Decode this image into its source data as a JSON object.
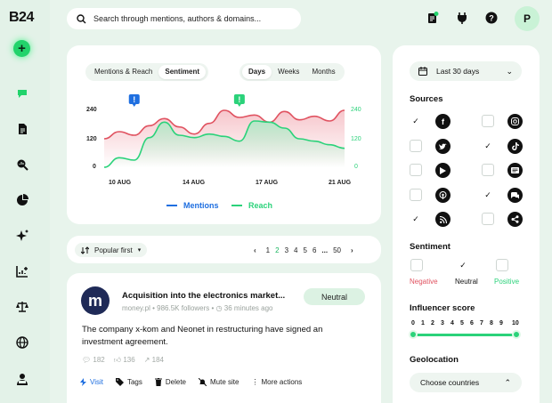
{
  "app": {
    "logo": "B24",
    "avatar_initial": "P"
  },
  "search": {
    "placeholder": "Search through mentions, authors & domains..."
  },
  "nav": {
    "items": [
      "chat-icon",
      "document-icon",
      "search-analytics-icon",
      "pie-chart-icon",
      "sparkle-icon",
      "chart-plus-icon",
      "scales-icon",
      "globe-icon",
      "user-icon"
    ]
  },
  "chart_panel": {
    "tabs": [
      "Mentions & Reach",
      "Sentiment"
    ],
    "active_tab": "Sentiment",
    "ranges": [
      "Days",
      "Weeks",
      "Months"
    ],
    "active_range": "Days"
  },
  "chart_data": {
    "type": "line",
    "x": [
      "10 AUG",
      "14 AUG",
      "17 AUG",
      "21 AUG"
    ],
    "series": [
      {
        "name": "Mentions",
        "color": "#e05260",
        "values": [
          120,
          150,
          135,
          175,
          205,
          170,
          140,
          185,
          240,
          210,
          220,
          190,
          235,
          200,
          215,
          195,
          240
        ]
      },
      {
        "name": "Reach",
        "color": "#2bd27a",
        "values": [
          0,
          40,
          30,
          125,
          190,
          135,
          125,
          140,
          130,
          110,
          195,
          190,
          165,
          120,
          110,
          95,
          80
        ]
      }
    ],
    "y_left_ticks": [
      "240",
      "120",
      "0"
    ],
    "y_right_ticks": [
      "240",
      "120",
      "0"
    ],
    "ylim": [
      0,
      240
    ],
    "alerts": [
      {
        "at_index": 2,
        "color": "#1f6fe0"
      },
      {
        "at_index": 9,
        "color": "#2bd27a"
      }
    ]
  },
  "legend": {
    "mentions": "Mentions",
    "reach": "Reach"
  },
  "list_controls": {
    "sort_label": "Popular first",
    "pages": [
      "1",
      "2",
      "3",
      "4",
      "5",
      "6",
      "...",
      "50"
    ],
    "current_page": "2"
  },
  "post": {
    "logo_letter": "m",
    "title": "Acquisition into the electronics market...",
    "source": "money.pl",
    "followers": "986.5K followers",
    "time": "36 minutes ago",
    "sentiment": "Neutral",
    "body": "The company x-kom and Neonet in restructuring have signed an investment agreement.",
    "comments": "182",
    "likes": "136",
    "shares": "184",
    "actions": [
      "Visit",
      "Tags",
      "Delete",
      "Mute site",
      "More actions"
    ]
  },
  "filters": {
    "date_range": "Last 30 days",
    "sources_title": "Sources",
    "sources": [
      {
        "icon": "facebook-icon",
        "checked": true
      },
      {
        "icon": "instagram-icon",
        "checked": false
      },
      {
        "icon": "twitter-icon",
        "checked": false
      },
      {
        "icon": "tiktok-icon",
        "checked": true
      },
      {
        "icon": "video-icon",
        "checked": false
      },
      {
        "icon": "news-icon",
        "checked": false
      },
      {
        "icon": "podcast-icon",
        "checked": false
      },
      {
        "icon": "forum-icon",
        "checked": true
      },
      {
        "icon": "rss-icon",
        "checked": true
      },
      {
        "icon": "share-icon",
        "checked": false
      }
    ],
    "sentiment_title": "Sentiment",
    "sentiments": [
      {
        "label": "Negative",
        "color": "#e05260",
        "checked": false
      },
      {
        "label": "Neutral",
        "color": "#111111",
        "checked": true
      },
      {
        "label": "Positive",
        "color": "#2bd27a",
        "checked": false
      }
    ],
    "influencer_title": "Influencer score",
    "influencer_ticks": [
      "0",
      "1",
      "2",
      "3",
      "4",
      "5",
      "6",
      "7",
      "8",
      "9",
      "10"
    ],
    "influencer_range": [
      0,
      10
    ],
    "geo_title": "Geolocation",
    "geo_button": "Choose countries"
  }
}
